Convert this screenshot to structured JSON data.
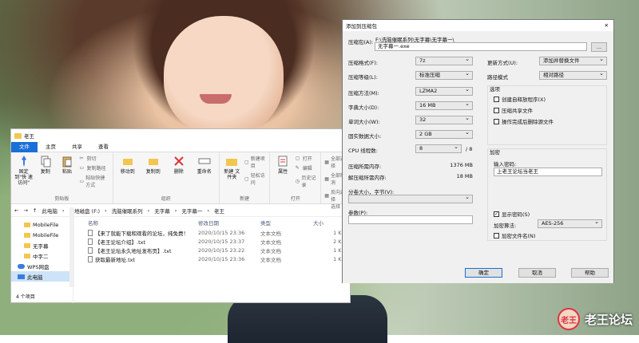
{
  "explorer": {
    "title": "老王",
    "tabs": [
      "文件",
      "主页",
      "共享",
      "查看"
    ],
    "ribbon": {
      "clipboard": {
        "pin": "固定到\"快\n速访问\"",
        "copy": "复制",
        "paste": "粘贴",
        "cut": "剪切",
        "copy_path": "复制路径",
        "paste_shortcut": "粘贴快捷方式",
        "group": "剪贴板"
      },
      "organize": {
        "move_to": "移动到",
        "copy_to": "复制到",
        "delete": "删除",
        "rename": "重命名",
        "group": "组织"
      },
      "new": {
        "new_folder": "新建\n文件夹",
        "new_item": "新建项目",
        "easy_access": "轻松访问",
        "group": "新建"
      },
      "open": {
        "properties": "属性",
        "open": "打开",
        "edit": "编辑",
        "history": "历史记录",
        "group": "打开"
      },
      "select": {
        "select_all": "全部选择",
        "select_none": "全部取消",
        "invert": "反向选择",
        "group": "选择"
      }
    },
    "address": [
      "此电脑",
      "本地磁盘 (F:)",
      "洗脑催眠系列",
      "无字幕",
      "无字幕一",
      "老王"
    ],
    "nav_items": [
      {
        "label": "MobileFile",
        "icon": "folder-icon"
      },
      {
        "label": "MobileFile",
        "icon": "folder-icon"
      },
      {
        "label": "无字幕",
        "icon": "folder-icon"
      },
      {
        "label": "中字二",
        "icon": "folder-icon"
      },
      {
        "label": "WPS网盘",
        "icon": "cloud-icon"
      },
      {
        "label": "此电脑",
        "icon": "computer-icon"
      }
    ],
    "columns": [
      "名称",
      "修改日期",
      "类型",
      "大小"
    ],
    "files": [
      {
        "name": "【来了就能下载和观看的论坛，纯免费！",
        "date": "2020/10/15 23:36",
        "type": "文本文档",
        "size": "1 KB"
      },
      {
        "name": "【老王论坛介绍】.txt",
        "date": "2020/10/15 23:37",
        "type": "文本文档",
        "size": "2 KB"
      },
      {
        "name": "【老王论坛永久地址发布页】.txt",
        "date": "2020/10/15 23:22",
        "type": "文本文档",
        "size": "1 KB"
      },
      {
        "name": "获取最新地址.txt",
        "date": "2020/10/15 23:36",
        "type": "文本文档",
        "size": "1 KB"
      }
    ],
    "status": "4 个项目"
  },
  "dialog": {
    "title": "添加到压缩包",
    "archive_name_label": "压缩包(A):",
    "archive_path": "F:\\洗脑催眠系列\\无字幕\\无字幕一\\",
    "archive_name": "无字幕一.exe",
    "browse": "...",
    "format_label": "压缩格式(F):",
    "format": "7z",
    "level_label": "压缩等级(L):",
    "level": "标准压缩",
    "method_label": "压缩方法(M):",
    "method": "LZMA2",
    "dict_label": "字典大小(D):",
    "dict": "16 MB",
    "word_label": "单词大小(W):",
    "word": "32",
    "solid_label": "固实数据大小:",
    "solid": "2 GB",
    "threads_label": "CPU 线程数:",
    "threads": "8",
    "threads_total": "/ 8",
    "mem_compress_label": "压缩所需内存:",
    "mem_compress": "1376 MB",
    "mem_decompress_label": "解压缩所需内存:",
    "mem_decompress": "18 MB",
    "split_label": "分卷大小，字节(V):",
    "params_label": "参数(P):",
    "update_label": "更新方式(U):",
    "update": "添加并替换文件",
    "path_label": "路径模式",
    "path": "相对路径",
    "options_title": "选项",
    "options": [
      "创建自释放程序(X)",
      "压缩共享文件",
      "操作完成后删除源文件"
    ],
    "encrypt_title": "加密",
    "password_label": "输入密码:",
    "password": "上老王论坛当老王",
    "show_password": "显示密码(S)",
    "encrypt_method_label": "加密算法:",
    "encrypt_method": "AES-256",
    "encrypt_names": "加密文件名(N)",
    "ok": "确定",
    "cancel": "取消",
    "help": "帮助"
  },
  "watermark": {
    "text": "老王论坛",
    "logo_text": "老王"
  }
}
